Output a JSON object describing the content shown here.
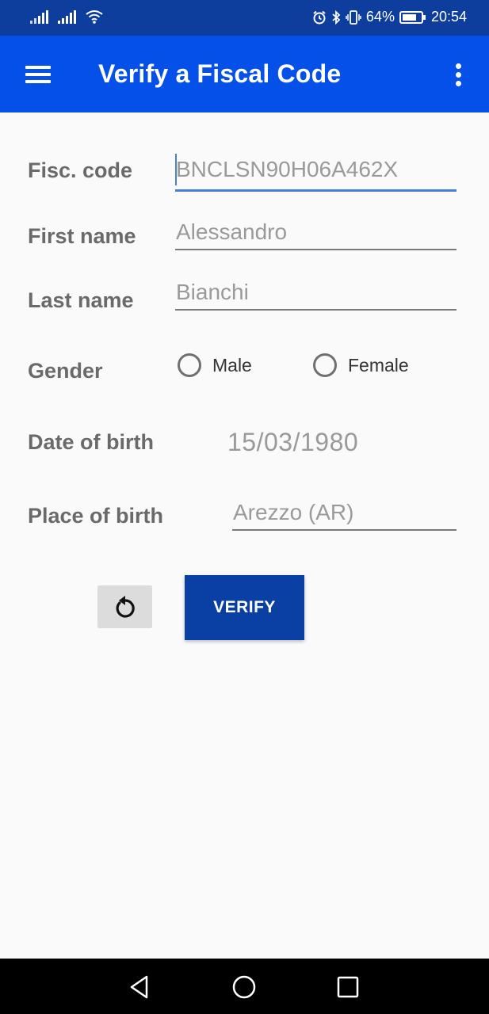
{
  "status_bar": {
    "battery_percent": "64%",
    "time": "20:54",
    "icons": [
      "signal-icon",
      "signal-icon",
      "wifi-icon",
      "alarm-icon",
      "bluetooth-icon",
      "vibrate-icon",
      "battery-icon"
    ]
  },
  "app_bar": {
    "title": "Verify a Fiscal Code",
    "background": "#0450e8"
  },
  "form": {
    "fiscal_code": {
      "label": "Fisc. code",
      "value": "BNCLSN90H06A462X"
    },
    "first_name": {
      "label": "First name",
      "value": "Alessandro"
    },
    "last_name": {
      "label": "Last name",
      "value": "Bianchi"
    },
    "gender": {
      "label": "Gender",
      "options": [
        "Male",
        "Female"
      ],
      "selected": null
    },
    "date_of_birth": {
      "label": "Date of birth",
      "value": "15/03/1980"
    },
    "place_of_birth": {
      "label": "Place of birth",
      "value": "Arezzo (AR)"
    }
  },
  "actions": {
    "verify_label": "VERIFY",
    "reset_icon": "refresh-icon",
    "accent": "#0a3fa3"
  },
  "nav_bar": {
    "icons": [
      "back-icon",
      "home-icon",
      "recents-icon"
    ]
  }
}
